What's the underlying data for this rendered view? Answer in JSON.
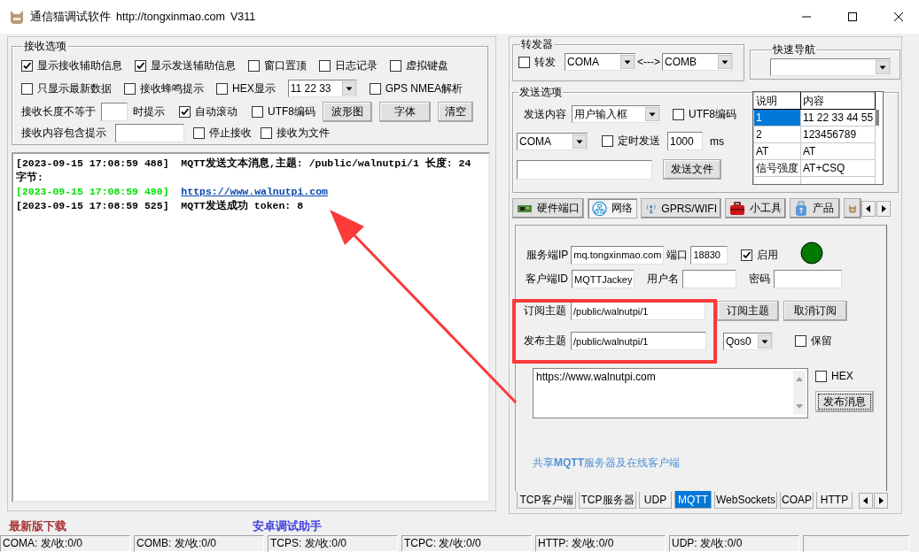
{
  "window": {
    "title": "通信猫调试软件",
    "url": "http://tongxinmao.com",
    "version": "V311"
  },
  "receive": {
    "title": "接收选项",
    "rows": [
      {
        "items": [
          {
            "kind": "check",
            "label": "显示接收辅助信息",
            "checked": true
          },
          {
            "kind": "check",
            "label": "显示发送辅助信息",
            "checked": true
          },
          {
            "kind": "check",
            "label": "窗口置顶",
            "checked": false
          },
          {
            "kind": "check",
            "label": "日志记录",
            "checked": false
          },
          {
            "kind": "check",
            "label": "虚拟键盘",
            "checked": false
          }
        ]
      },
      {
        "items": [
          {
            "kind": "check",
            "label": "只显示最新数据",
            "checked": false
          },
          {
            "kind": "check",
            "label": "接收蜂鸣提示",
            "checked": false
          },
          {
            "kind": "check",
            "label": "HEX显示",
            "checked": false
          },
          {
            "kind": "combo",
            "value": "11 22 33"
          },
          {
            "kind": "check",
            "label": "GPS NMEA解析",
            "checked": false
          }
        ]
      },
      {
        "items": [
          {
            "kind": "label",
            "text": "接收长度不等于"
          },
          {
            "kind": "field"
          },
          {
            "kind": "label",
            "text": "时提示"
          },
          {
            "kind": "check",
            "label": "自动滚动",
            "checked": true
          },
          {
            "kind": "check",
            "label": "UTF8编码",
            "checked": false
          },
          {
            "kind": "button",
            "label": "波形图"
          },
          {
            "kind": "button",
            "label": "字体"
          },
          {
            "kind": "button",
            "label": "清空"
          }
        ]
      },
      {
        "items": [
          {
            "kind": "label",
            "text": "接收内容包含提示"
          },
          {
            "kind": "field"
          },
          {
            "kind": "check",
            "label": "停止接收",
            "checked": false
          },
          {
            "kind": "check",
            "label": "接收为文件",
            "checked": false
          }
        ]
      }
    ]
  },
  "log": {
    "lines": [
      {
        "kind": "info",
        "time": "[2023-09-15 17:08:59 488]",
        "text": "MQTT发送文本消息,主题: /public/walnutpi/1 长度: 24 字节:"
      },
      {
        "kind": "link",
        "time": "[2023-09-15 17:08:59 490]",
        "text": "https://www.walnutpi.com"
      },
      {
        "kind": "info",
        "time": "[2023-09-15 17:08:59 525]",
        "text": "MQTT发送成功 token: 8"
      }
    ]
  },
  "links": [
    {
      "text": "最新版下载",
      "color": "#a83232"
    },
    {
      "text": "安卓调试助手",
      "color": "#4040e0"
    }
  ],
  "forwarder": {
    "title": "转发器",
    "enable": {
      "label": "转发",
      "checked": false
    },
    "from": "COMA",
    "separator": "<--->",
    "to": "COMB"
  },
  "quick_nav": {
    "title": "快速导航"
  },
  "send_options": {
    "title": "发送选项",
    "content_label": "发送内容",
    "content_source": "用户输入框",
    "utf8": {
      "label": "UTF8编码",
      "checked": false
    },
    "port": "COMA",
    "timed": {
      "label": "定时发送",
      "checked": false
    },
    "interval": "1000",
    "interval_unit": "ms",
    "send_file": "发送文件",
    "table": {
      "columns": [
        "说明",
        "内容"
      ],
      "rows": [
        {
          "cells": [
            "1",
            "11 22 33 44 55"
          ],
          "selected": true
        },
        {
          "cells": [
            "2",
            "123456789"
          ],
          "selected": false
        },
        {
          "cells": [
            "AT",
            "AT"
          ],
          "selected": false
        },
        {
          "cells": [
            "信号强度",
            "AT+CSQ"
          ],
          "selected": false
        }
      ]
    }
  },
  "tabs": [
    {
      "label": "硬件端口",
      "selected": false
    },
    {
      "label": "网络",
      "selected": true
    },
    {
      "label": "GPRS/WIFI",
      "selected": false
    },
    {
      "label": "小工具",
      "selected": false
    },
    {
      "label": "产品",
      "selected": false
    },
    {
      "selected": false
    }
  ],
  "mqtt": {
    "server_label": "服务端IP",
    "server": "mq.tongxinmao.com",
    "port_label": "端口",
    "port": "18830",
    "enable": {
      "label": "启用",
      "checked": true
    },
    "connected": true,
    "client_label": "客户端ID",
    "client_id": "MQTTJackey",
    "user_label": "用户名",
    "password_label": "密码",
    "subscribe_label": "订阅主题",
    "subscribe_topic": "/public/walnutpi/1",
    "subscribe_button": "订阅主题",
    "unsubscribe_button": "取消订阅",
    "publish_label": "发布主题",
    "publish_topic": "/public/walnutpi/1",
    "qos": "Qos0",
    "retain": {
      "label": "保留",
      "checked": false
    },
    "message": "https://www.walnutpi.com",
    "hex": {
      "label": "HEX",
      "checked": false
    },
    "publish_button": "发布消息",
    "share_link": "共享**MQTT**服务器及在线客户端"
  },
  "protocol_tabs": [
    {
      "label": "TCP客户端",
      "selected": false
    },
    {
      "label": "TCP服务器",
      "selected": false
    },
    {
      "label": "UDP",
      "selected": false
    },
    {
      "label": "MQTT",
      "selected": true
    },
    {
      "label": "WebSockets",
      "selected": false
    },
    {
      "label": "COAP",
      "selected": false
    },
    {
      "label": "HTTP",
      "selected": false
    }
  ],
  "status_bar": [
    "COMA: 发/收:0/0",
    "COMB: 发/收:0/0",
    "TCPS: 发/收:0/0",
    "TCPC: 发/收:0/0",
    "HTTP: 发/收:0/0",
    "UDP: 发/收:0/0"
  ]
}
